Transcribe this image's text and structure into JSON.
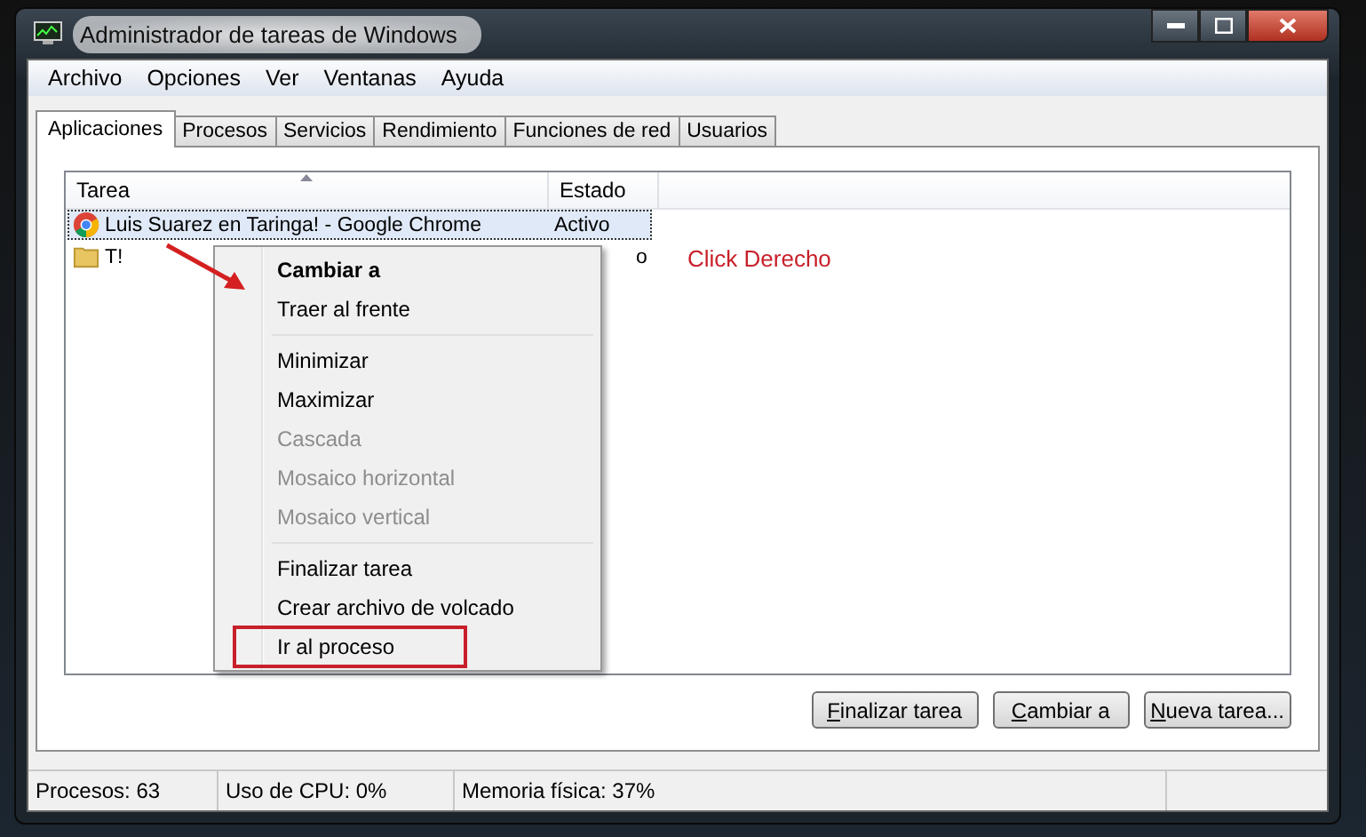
{
  "window": {
    "title": "Administrador de tareas de Windows"
  },
  "menu_bar": [
    "Archivo",
    "Opciones",
    "Ver",
    "Ventanas",
    "Ayuda"
  ],
  "tabs": [
    {
      "label": "Aplicaciones",
      "selected": true
    },
    {
      "label": "Procesos",
      "selected": false
    },
    {
      "label": "Servicios",
      "selected": false
    },
    {
      "label": "Rendimiento",
      "selected": false
    },
    {
      "label": "Funciones de red",
      "selected": false
    },
    {
      "label": "Usuarios",
      "selected": false
    }
  ],
  "table": {
    "columns": [
      "Tarea",
      "Estado"
    ],
    "rows": [
      {
        "task": "Luis Suarez en Taringa! - Google Chrome",
        "status": "Activo",
        "selected": true
      },
      {
        "task": "T!",
        "status": "o",
        "selected": false
      }
    ]
  },
  "context_menu": [
    {
      "kind": "item",
      "label": "Cambiar a",
      "default": true,
      "disabled": false,
      "highlighted": false
    },
    {
      "kind": "item",
      "label": "Traer al frente",
      "default": false,
      "disabled": false,
      "highlighted": false
    },
    {
      "kind": "separator"
    },
    {
      "kind": "item",
      "label": "Minimizar",
      "default": false,
      "disabled": false,
      "highlighted": false
    },
    {
      "kind": "item",
      "label": "Maximizar",
      "default": false,
      "disabled": false,
      "highlighted": false
    },
    {
      "kind": "item",
      "label": "Cascada",
      "default": false,
      "disabled": true,
      "highlighted": false
    },
    {
      "kind": "item",
      "label": "Mosaico horizontal",
      "default": false,
      "disabled": true,
      "highlighted": false
    },
    {
      "kind": "item",
      "label": "Mosaico vertical",
      "default": false,
      "disabled": true,
      "highlighted": false
    },
    {
      "kind": "separator"
    },
    {
      "kind": "item",
      "label": "Finalizar tarea",
      "default": false,
      "disabled": false,
      "highlighted": false
    },
    {
      "kind": "item",
      "label": "Crear archivo de volcado",
      "default": false,
      "disabled": false,
      "highlighted": false
    },
    {
      "kind": "item",
      "label": "Ir al proceso",
      "default": false,
      "disabled": false,
      "highlighted": true
    }
  ],
  "annotation": "Click Derecho",
  "buttons": [
    "Finalizar tarea",
    "Cambiar a",
    "Nueva tarea..."
  ],
  "status_bar": [
    "Procesos: 63",
    "Uso de CPU: 0%",
    "Memoria física: 37%"
  ]
}
